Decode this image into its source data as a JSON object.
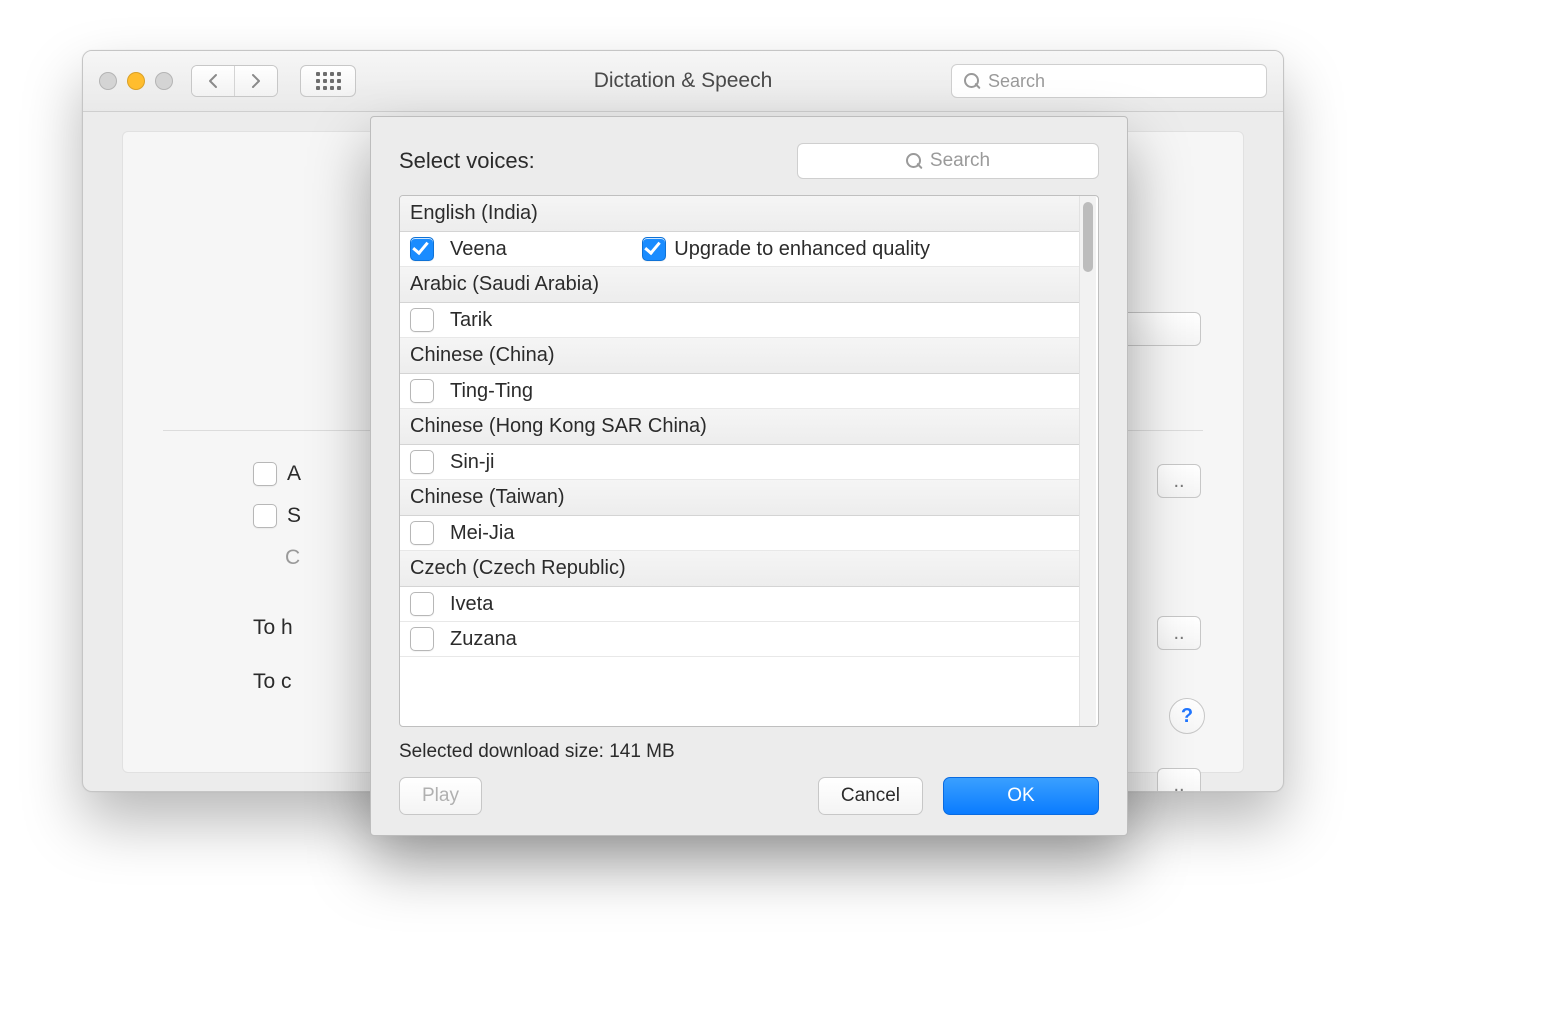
{
  "window": {
    "title": "Dictation & Speech",
    "search_placeholder": "Search"
  },
  "background_options": {
    "row_a": "A",
    "row_s": "S",
    "row_c": "C",
    "row_to_h": "To h",
    "row_to_c": "To c"
  },
  "help_label": "?",
  "sheet": {
    "title": "Select voices:",
    "search_placeholder": "Search",
    "upgrade_label": "Upgrade to enhanced quality",
    "groups": [
      {
        "language": "English (India)",
        "voices": [
          {
            "name": "Veena",
            "checked": true,
            "upgrade": true
          }
        ]
      },
      {
        "language": "Arabic (Saudi Arabia)",
        "voices": [
          {
            "name": "Tarik",
            "checked": false
          }
        ]
      },
      {
        "language": "Chinese (China)",
        "voices": [
          {
            "name": "Ting-Ting",
            "checked": false
          }
        ]
      },
      {
        "language": "Chinese (Hong Kong SAR China)",
        "voices": [
          {
            "name": "Sin-ji",
            "checked": false
          }
        ]
      },
      {
        "language": "Chinese (Taiwan)",
        "voices": [
          {
            "name": "Mei-Jia",
            "checked": false
          }
        ]
      },
      {
        "language": "Czech (Czech Republic)",
        "voices": [
          {
            "name": "Iveta",
            "checked": false
          },
          {
            "name": "Zuzana",
            "checked": false
          }
        ]
      }
    ],
    "status": "Selected download size: 141 MB",
    "buttons": {
      "play": "Play",
      "cancel": "Cancel",
      "ok": "OK"
    }
  }
}
